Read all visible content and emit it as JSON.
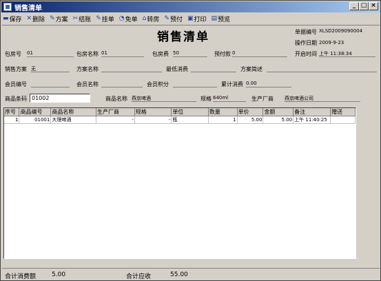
{
  "window": {
    "title": "销售清单",
    "min": "_",
    "max": "□",
    "close": "×"
  },
  "toolbar": [
    {
      "icon": "save-icon",
      "glyph": "▬",
      "label": "保存"
    },
    {
      "icon": "delete-icon",
      "glyph": "✕",
      "label": "删除"
    },
    {
      "icon": "plan-icon",
      "glyph": "✎",
      "label": "方案"
    },
    {
      "icon": "checkout-icon",
      "glyph": "✂",
      "label": "结账"
    },
    {
      "icon": "hold-icon",
      "glyph": "✎",
      "label": "挂单"
    },
    {
      "icon": "free-icon",
      "glyph": "◔",
      "label": "免单"
    },
    {
      "icon": "room-icon",
      "glyph": "⌂",
      "label": "转房"
    },
    {
      "icon": "prepay-icon",
      "glyph": "✎",
      "label": "预付"
    },
    {
      "icon": "print-icon",
      "glyph": "▣",
      "label": "打印"
    },
    {
      "icon": "preview-icon",
      "glyph": "▤",
      "label": "预览"
    }
  ],
  "form": {
    "title": "销售清单",
    "doc_no_label": "单据编号",
    "doc_no": "XLSD2009090004",
    "op_date_label": "操作日期",
    "op_date": "2009-9-23",
    "room_no_label": "包房号",
    "room_no": "01",
    "room_name_label": "包房名称",
    "room_name": "01",
    "room_fee_label": "包房费",
    "room_fee": "50",
    "prepay_label": "预付款",
    "prepay": "0",
    "open_time_label": "开启时间",
    "open_time": "上午 11:38:34",
    "plan_label": "销售方案",
    "plan": "无",
    "plan_name_label": "方案名称",
    "plan_name": "",
    "min_spend_label": "最低消费",
    "min_spend": "",
    "plan_desc_label": "方案简述",
    "plan_desc": "",
    "member_no_label": "会员编号",
    "member_no": "",
    "member_name_label": "会员名称",
    "member_name": "",
    "member_points_label": "会员积分",
    "member_points": "",
    "total_spend_label": "累计消费",
    "total_spend": "0.00",
    "barcode_label": "商品条码",
    "barcode": "01002",
    "product_name_label": "商品名称",
    "product_name": "燕京啤酒",
    "spec_label": "规格",
    "spec": "640ml",
    "maker_label": "生产厂商",
    "maker": "燕京啤酒公司"
  },
  "grid": {
    "columns": [
      "序号",
      "商品编号",
      "商品名称",
      "生产厂商",
      "规格",
      "单位",
      "数量",
      "单价",
      "金额",
      "备注",
      "赠送"
    ],
    "rows": [
      [
        "1",
        "01001",
        "大理啤酒",
        "-",
        "-",
        "瓶",
        "1",
        "5.00",
        "5.00",
        "上午 11:40:25",
        ""
      ]
    ]
  },
  "footer": {
    "total_spend_label": "合计消费额",
    "total_spend": "5.00",
    "total_receivable_label": "合计应收",
    "total_receivable": "55.00"
  }
}
